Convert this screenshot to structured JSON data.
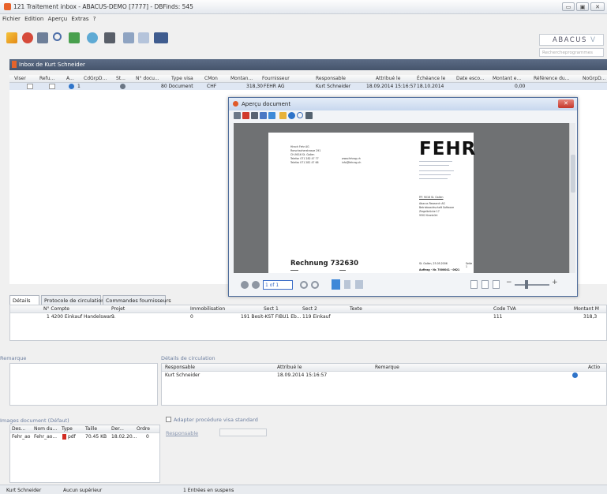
{
  "window": {
    "title": "121 Traitement inbox - ABACUS-DEMO [7777] - DBFinds: 545",
    "btn_min": "▭",
    "btn_max": "▣",
    "btn_close": "✕"
  },
  "menu": [
    "Fichier",
    "Edition",
    "Aperçu",
    "Extras",
    "?"
  ],
  "logo": {
    "text": "ABACUS",
    "suffix": "V"
  },
  "search": {
    "placeholder": "Rechercheprogrammes"
  },
  "inbox": {
    "title": "Inbox de Kurt Schneider"
  },
  "grid": {
    "columns": [
      "Viser",
      "Refu...",
      "A...",
      "CdGrpD...",
      "St...",
      "N° docu...",
      "Type visa",
      "CMon",
      "Montan...",
      "Fournisseur",
      "Responsable",
      "Attribué le",
      "Échéance le",
      "Date esco...",
      "Montant e...",
      "Référence du...",
      "NoGrpD..."
    ],
    "row": {
      "n1": "1",
      "n2": "0",
      "doc": "80 Document",
      "cur": "CHF",
      "amount": "318,30",
      "supplier": "FEHR AG",
      "responsible": "Kurt Schneider",
      "assigned": "18.09.2014 15:16:57",
      "due": "18.10.2014",
      "montant_e": "0,00"
    }
  },
  "tabs": [
    "Détails",
    "Protocole de circulation",
    "Commandes fournisseurs"
  ],
  "details": {
    "columns": [
      "N° Compte",
      "Projet",
      "Immobilisation",
      "Sect 1",
      "Sect 2",
      "Texte",
      "Code TVA",
      "Montant M"
    ],
    "row": [
      "1 4200 Einkauf Handelswar...",
      "9",
      "0",
      "191 Besit-KST FIBU1 Eb...",
      "119 Einkauf",
      "",
      "111",
      "318,3"
    ]
  },
  "remarque": {
    "label": "Remarque"
  },
  "circulation": {
    "label": "Détails de circulation",
    "columns": [
      "Responsable",
      "Attribué le",
      "Remarque",
      "Actio"
    ],
    "row": [
      "Kurt Schneider",
      "18.09.2014 15:16:57",
      ""
    ]
  },
  "images": {
    "label": "Images document (Défaut)",
    "columns": [
      "Des...",
      "Nom du...",
      "Type",
      "Taille",
      "Der...",
      "Ordre"
    ],
    "row": [
      "Fehr_ao",
      "Fehr_ao...",
      "pdf",
      "70.45 KB",
      "18.02.20...",
      "0"
    ]
  },
  "procedure": {
    "checkbox_label": "Adapter procédure visa standard",
    "responsable_label": "Responsable"
  },
  "statusbar": [
    "Kurt Schneider",
    "Aucun supérieur",
    "1 Entrées en suspens"
  ],
  "viewer": {
    "title": "Aperçu document",
    "close": "✕",
    "page_field": "1 of 1",
    "zoom_minus": "−",
    "zoom_plus": "+",
    "document": {
      "company": "FEHR",
      "sender_lines": [
        "Hirsch Fehr AG",
        "Rorschacherstrasse 291",
        "CH-9016 St. Gallen",
        "Telefon 071 282 47 77",
        "Telefax 071 282 47 66"
      ],
      "web": [
        "www.fehrag.ch",
        "info@fehrag.ch"
      ],
      "city_line": "P.P. 9016 St. Gallen",
      "recipient": [
        "Abacus Research AG",
        "Betriebswirtschaft Software",
        "Ziegelbrücke 17",
        "9302 Kronbühl"
      ],
      "invoice_title": "Rechnung 732630",
      "date_line": "St. Gallen, 23.05.2006",
      "page_label": "Seite 1",
      "auftrag": "Auftrag - Nr. 7000041 - 0621"
    }
  },
  "colors": {
    "accent": "#4f6d9c",
    "brand": "#e4632b",
    "header_bg": "#5b6b85"
  }
}
